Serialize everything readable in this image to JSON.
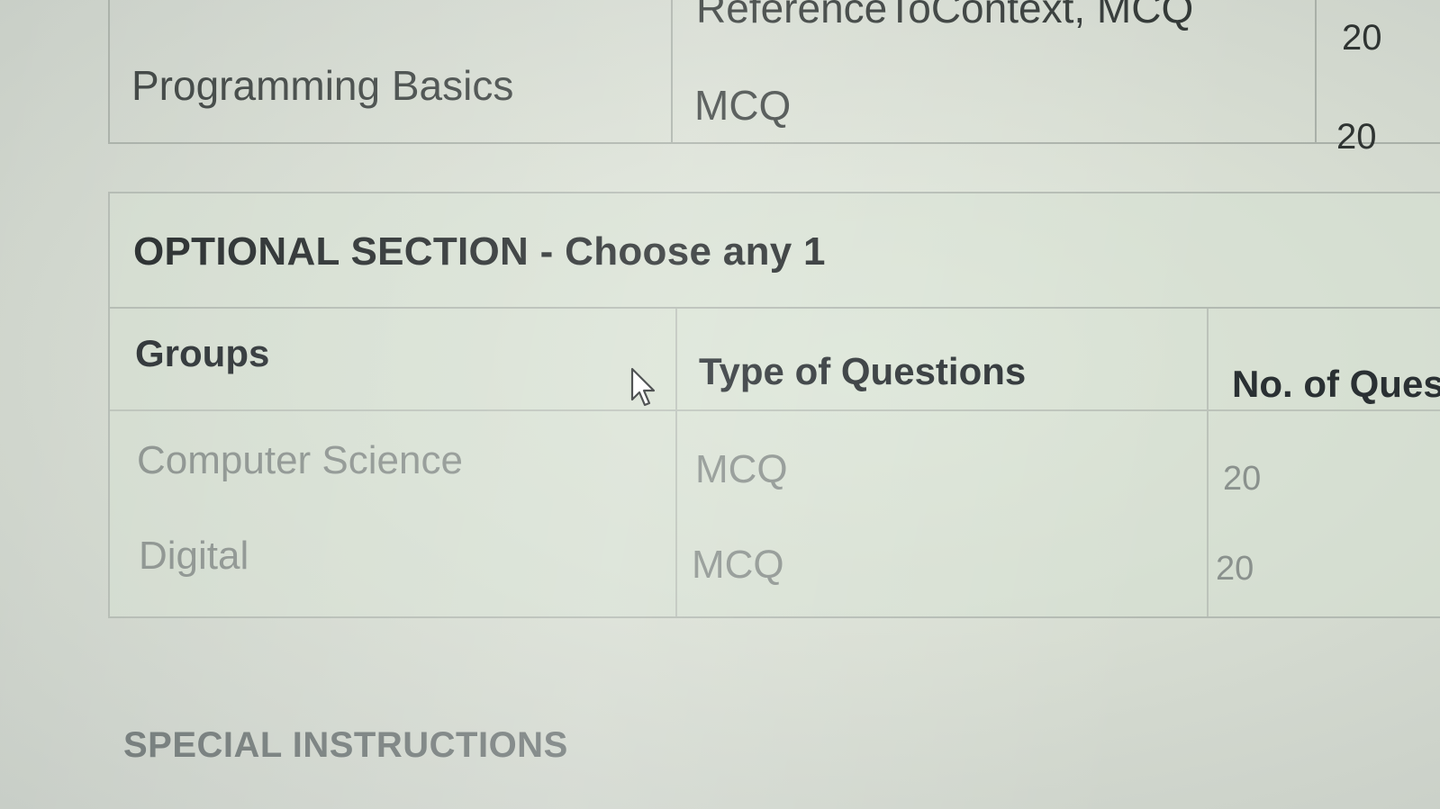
{
  "top_table": {
    "rows": [
      {
        "group": "",
        "types": "ReferenceToContext, MCQ",
        "count": "20"
      },
      {
        "group": "Programming Basics",
        "types": "MCQ",
        "count": "20"
      }
    ]
  },
  "optional_section": {
    "title": "OPTIONAL SECTION - Choose any 1",
    "columns": [
      "Groups",
      "Type of Questions",
      "No. of Ques"
    ],
    "rows": [
      {
        "group": "Computer Science",
        "types": "MCQ",
        "count": "20"
      },
      {
        "group": "Digital",
        "types": "MCQ",
        "count": "20"
      }
    ]
  },
  "special_instructions": {
    "heading": "SPECIAL INSTRUCTIONS"
  },
  "icons": {
    "cursor": "mouse-pointer-icon"
  }
}
